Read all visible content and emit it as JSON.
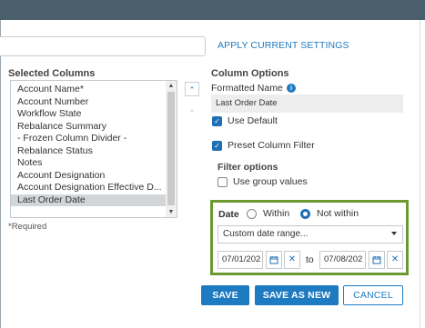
{
  "header": {},
  "name_field": {
    "value": ""
  },
  "apply_link": "APPLY CURRENT SETTINGS",
  "selected_columns": {
    "label": "Selected Columns",
    "items": [
      "Account Name*",
      "Account Number",
      "Workflow State",
      "Rebalance Summary",
      "- Frozen Column Divider -",
      "Rebalance Status",
      "Notes",
      "Account Designation",
      "Account Designation Effective D...",
      "Last Order Date"
    ],
    "selected_item": "Last Order Date",
    "required_note": "*Required"
  },
  "column_options": {
    "label": "Column Options",
    "formatted_name_label": "Formatted Name",
    "formatted_name_value": "Last Order Date",
    "use_default": {
      "label": "Use Default",
      "checked": true
    },
    "preset_filter": {
      "label": "Preset Column Filter",
      "checked": true
    },
    "filter_options_label": "Filter options",
    "use_group_values": {
      "label": "Use group values",
      "checked": false
    }
  },
  "date_filter": {
    "label": "Date",
    "within_label": "Within",
    "not_within_label": "Not within",
    "selected_radio": "Not within",
    "range_select_value": "Custom date range...",
    "from_date": "07/01/202",
    "to_label": "to",
    "to_date": "07/08/202"
  },
  "buttons": {
    "save": "SAVE",
    "save_as_new": "SAVE AS NEW",
    "cancel": "CANCEL"
  },
  "icons": {
    "info": "info-icon",
    "calendar": "calendar-icon",
    "clear": "close-icon",
    "move_up": "chevron-up-icon",
    "move_down": "chevron-down-icon",
    "dropdown": "caret-down-icon"
  },
  "colors": {
    "header_bar": "#4a5e6c",
    "accent": "#1f7bc1",
    "highlight_border": "#6a9a2f",
    "selected_row": "#d3d6d9"
  }
}
